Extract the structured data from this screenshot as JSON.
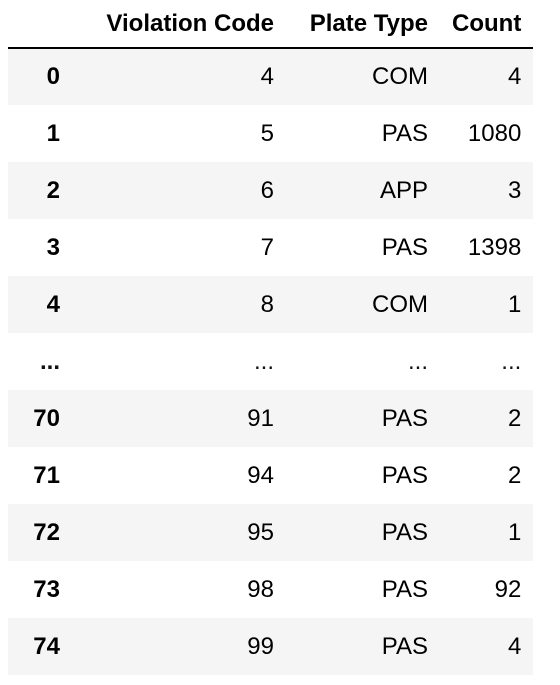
{
  "table": {
    "columns": {
      "index": "",
      "violation_code": "Violation Code",
      "plate_type": "Plate Type",
      "count": "Count"
    },
    "rows": [
      {
        "index": "0",
        "violation_code": "4",
        "plate_type": "COM",
        "count": "4"
      },
      {
        "index": "1",
        "violation_code": "5",
        "plate_type": "PAS",
        "count": "1080"
      },
      {
        "index": "2",
        "violation_code": "6",
        "plate_type": "APP",
        "count": "3"
      },
      {
        "index": "3",
        "violation_code": "7",
        "plate_type": "PAS",
        "count": "1398"
      },
      {
        "index": "4",
        "violation_code": "8",
        "plate_type": "COM",
        "count": "1"
      },
      {
        "index": "...",
        "violation_code": "...",
        "plate_type": "...",
        "count": "..."
      },
      {
        "index": "70",
        "violation_code": "91",
        "plate_type": "PAS",
        "count": "2"
      },
      {
        "index": "71",
        "violation_code": "94",
        "plate_type": "PAS",
        "count": "2"
      },
      {
        "index": "72",
        "violation_code": "95",
        "plate_type": "PAS",
        "count": "1"
      },
      {
        "index": "73",
        "violation_code": "98",
        "plate_type": "PAS",
        "count": "92"
      },
      {
        "index": "74",
        "violation_code": "99",
        "plate_type": "PAS",
        "count": "4"
      }
    ]
  },
  "colors": {
    "striped_row": "#f5f5f5",
    "header_border": "#000000",
    "text": "#000000"
  }
}
